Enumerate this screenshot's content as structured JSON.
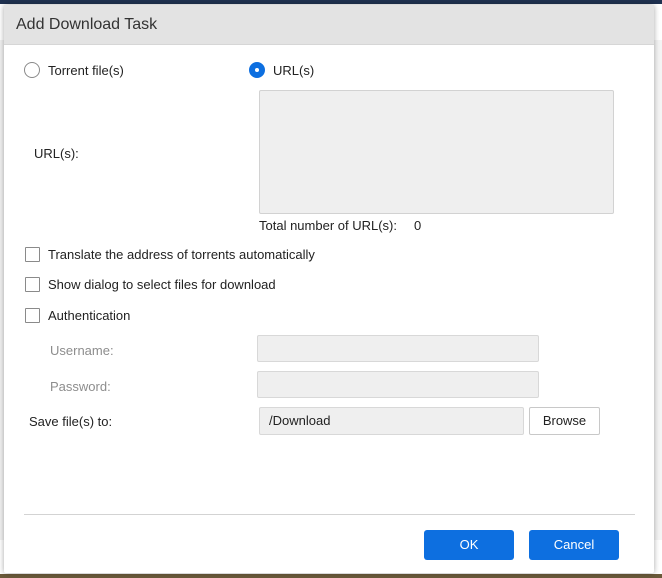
{
  "dialog": {
    "title": "Add Download Task"
  },
  "source": {
    "torrent_label": "Torrent file(s)",
    "url_label": "URL(s)",
    "selected": "url"
  },
  "urls": {
    "field_label": "URL(s):",
    "value": "",
    "total_label": "Total number of URL(s):",
    "total_count": "0"
  },
  "options": {
    "translate_label": "Translate the address of torrents automatically",
    "translate_checked": false,
    "show_dialog_label": "Show dialog to select files for download",
    "show_dialog_checked": false,
    "auth_label": "Authentication",
    "auth_checked": false
  },
  "auth": {
    "username_label": "Username:",
    "username_value": "",
    "password_label": "Password:",
    "password_value": ""
  },
  "save": {
    "label": "Save file(s) to:",
    "path": "/Download",
    "browse_label": "Browse"
  },
  "footer": {
    "ok_label": "OK",
    "cancel_label": "Cancel"
  },
  "colors": {
    "accent": "#0d6fe0",
    "field_bg": "#efefef",
    "header_bg": "#e3e3e3"
  }
}
